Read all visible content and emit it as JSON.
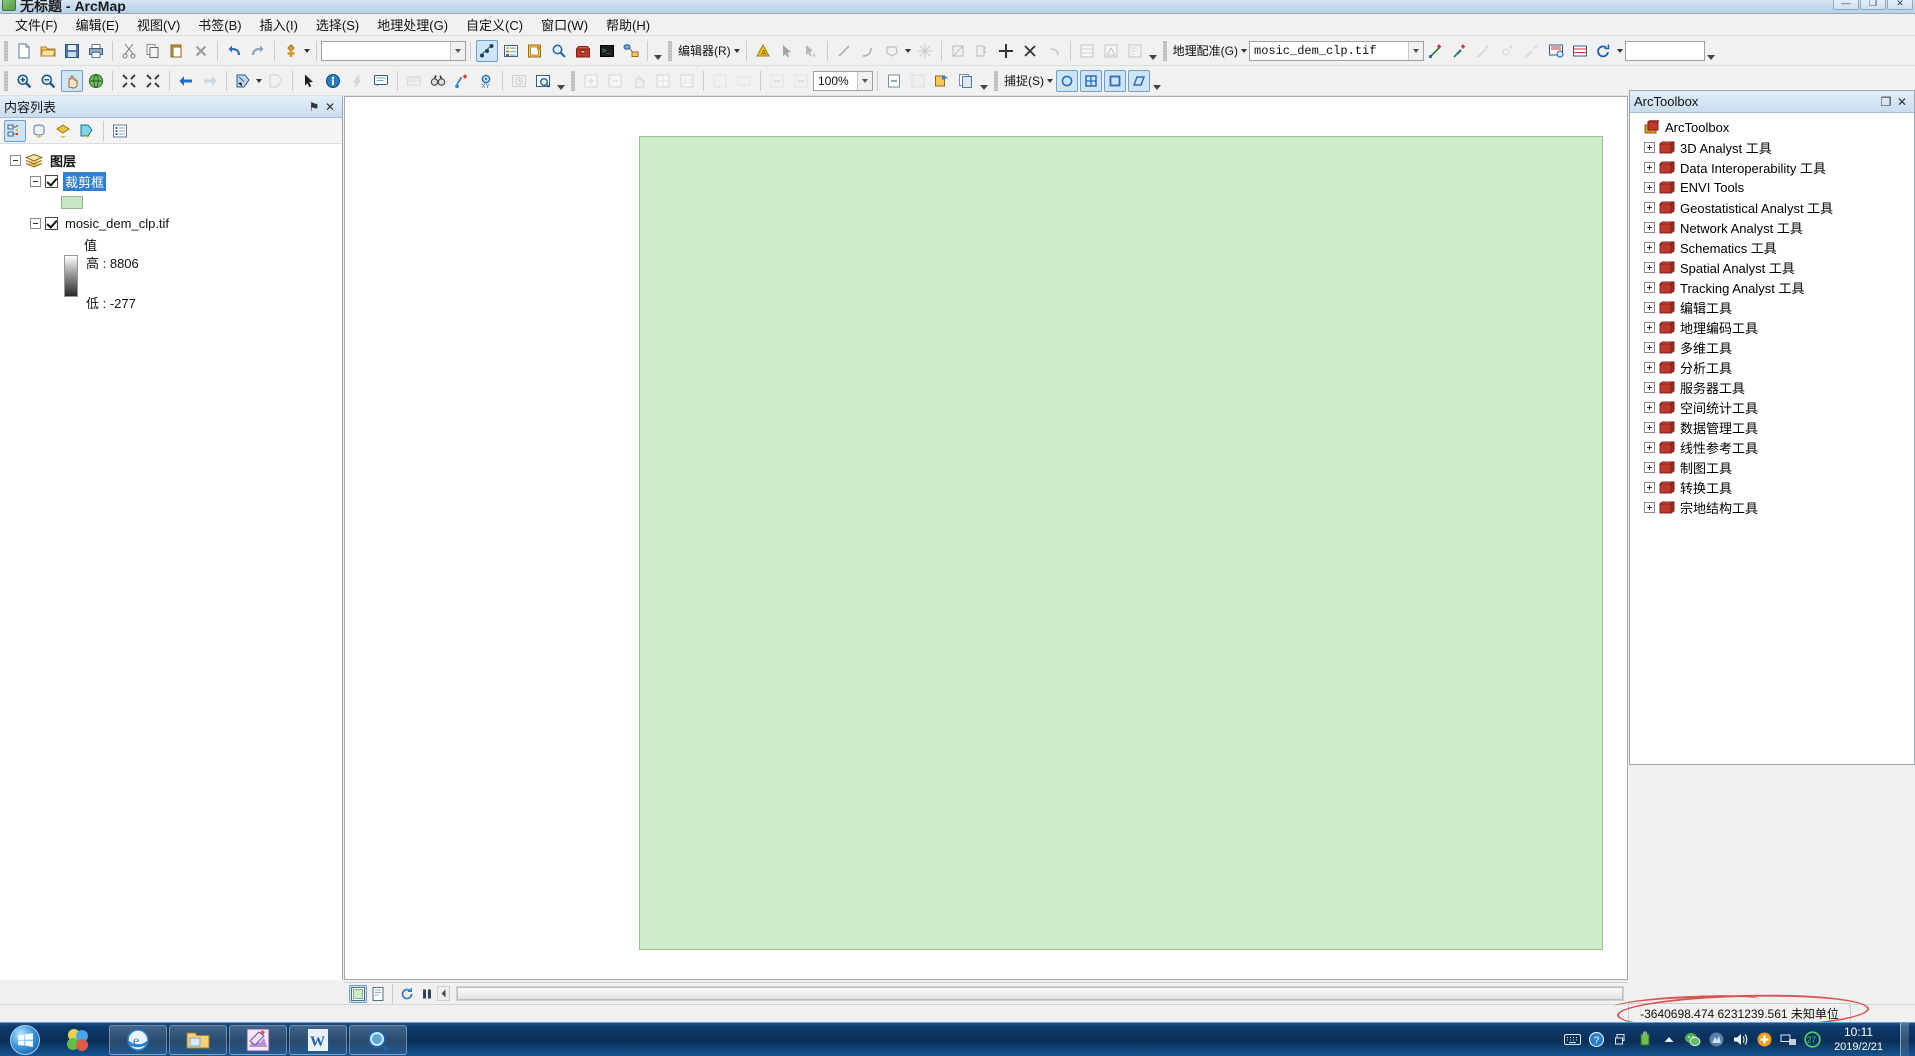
{
  "window": {
    "title": "无标题 - ArcMap",
    "minimize": "—",
    "maximize": "❐",
    "close": "✕"
  },
  "menu": {
    "items": [
      {
        "label": "文件(F)",
        "name": "menu-file"
      },
      {
        "label": "编辑(E)",
        "name": "menu-edit"
      },
      {
        "label": "视图(V)",
        "name": "menu-view"
      },
      {
        "label": "书签(B)",
        "name": "menu-bookmarks"
      },
      {
        "label": "插入(I)",
        "name": "menu-insert"
      },
      {
        "label": "选择(S)",
        "name": "menu-selection"
      },
      {
        "label": "地理处理(G)",
        "name": "menu-geoprocessing"
      },
      {
        "label": "自定义(C)",
        "name": "menu-customize"
      },
      {
        "label": "窗口(W)",
        "name": "menu-window"
      },
      {
        "label": "帮助(H)",
        "name": "menu-help"
      }
    ]
  },
  "standard_toolbar": {
    "scale_value": "",
    "editor_label": "编辑器(R)",
    "georef_label": "地理配准(G)",
    "georef_layer": "mosic_dem_clp.tif",
    "georef_extra_value": ""
  },
  "tools_toolbar": {
    "zoom_value": "100%",
    "snapping_label": "捕捉(S)"
  },
  "toc": {
    "title": "内容列表",
    "pin_glyph": "⚑",
    "close_glyph": "✕",
    "tree": {
      "root_label": "图层",
      "layers": [
        {
          "label": "裁剪框",
          "selected": true,
          "checked": true,
          "symbol": "polygon-green"
        },
        {
          "label": "mosic_dem_clp.tif",
          "selected": false,
          "checked": true,
          "symbol": "raster-ramp"
        }
      ],
      "raster_legend": {
        "value_label": "值",
        "high_label": "高 : 8806",
        "low_label": "低 : -277"
      }
    }
  },
  "arctoolbox": {
    "title": "ArcToolbox",
    "root_label": "ArcToolbox",
    "items": [
      {
        "label": "3D Analyst 工具"
      },
      {
        "label": "Data Interoperability 工具"
      },
      {
        "label": "ENVI Tools"
      },
      {
        "label": "Geostatistical Analyst 工具"
      },
      {
        "label": "Network Analyst 工具"
      },
      {
        "label": "Schematics 工具"
      },
      {
        "label": "Spatial Analyst 工具"
      },
      {
        "label": "Tracking Analyst 工具"
      },
      {
        "label": "编辑工具"
      },
      {
        "label": "地理编码工具"
      },
      {
        "label": "多维工具"
      },
      {
        "label": "分析工具"
      },
      {
        "label": "服务器工具"
      },
      {
        "label": "空间统计工具"
      },
      {
        "label": "数据管理工具"
      },
      {
        "label": "线性参考工具"
      },
      {
        "label": "制图工具"
      },
      {
        "label": "转换工具"
      },
      {
        "label": "宗地结构工具"
      }
    ],
    "maximize_glyph": "❐",
    "close_glyph": "✕"
  },
  "status": {
    "coordinates": "-3640698.474  6231239.561 未知单位"
  },
  "taskbar": {
    "clock_time": "10:11",
    "clock_date": "2019/2/21",
    "tray_count_badge": "27",
    "items": [
      {
        "name": "taskbar-internet-explorer"
      },
      {
        "name": "taskbar-windows-explorer"
      },
      {
        "name": "taskbar-arcmap"
      },
      {
        "name": "taskbar-word"
      },
      {
        "name": "taskbar-arccatalog"
      }
    ]
  },
  "colors": {
    "map_polygon_fill": "#cdecca",
    "map_polygon_stroke": "#9dbf9a",
    "selection_blue": "#2f7fd4",
    "annotation_red": "#d9534f",
    "toolbox_red": "#c0392b"
  }
}
